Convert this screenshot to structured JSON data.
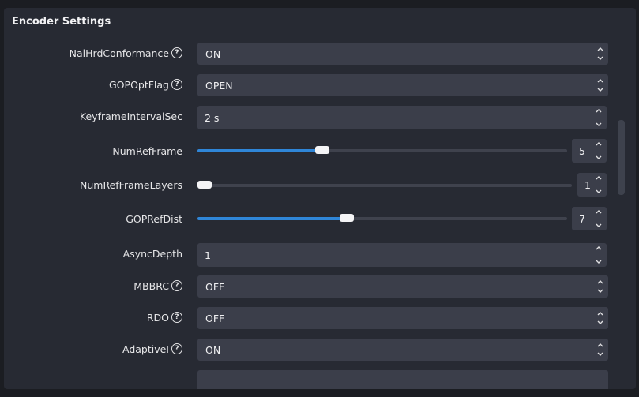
{
  "panel": {
    "title": "Encoder Settings"
  },
  "settings": {
    "nalhrd": {
      "label": "NalHrdConformance",
      "value": "ON"
    },
    "gopoptflag": {
      "label": "GOPOptFlag",
      "value": "OPEN"
    },
    "keyframe": {
      "label": "KeyframeIntervalSec",
      "value": "2 s"
    },
    "numrefframe": {
      "label": "NumRefFrame",
      "value": "5",
      "slider_fraction": 0.33
    },
    "numrefframelayers": {
      "label": "NumRefFrameLayers",
      "value": "1",
      "slider_fraction": 0.0
    },
    "goprefdist": {
      "label": "GOPRefDist",
      "value": "7",
      "slider_fraction": 0.4
    },
    "asyncdepth": {
      "label": "AsyncDepth",
      "value": "1"
    },
    "mbbrc": {
      "label": "MBBRC",
      "value": "OFF"
    },
    "rdo": {
      "label": "RDO",
      "value": "OFF"
    },
    "adaptivei": {
      "label": "AdaptiveI",
      "value": "ON"
    }
  },
  "help_glyph": "?",
  "colors": {
    "accent": "#2f86d8",
    "panel": "#272a33",
    "field": "#3b3e4a"
  }
}
